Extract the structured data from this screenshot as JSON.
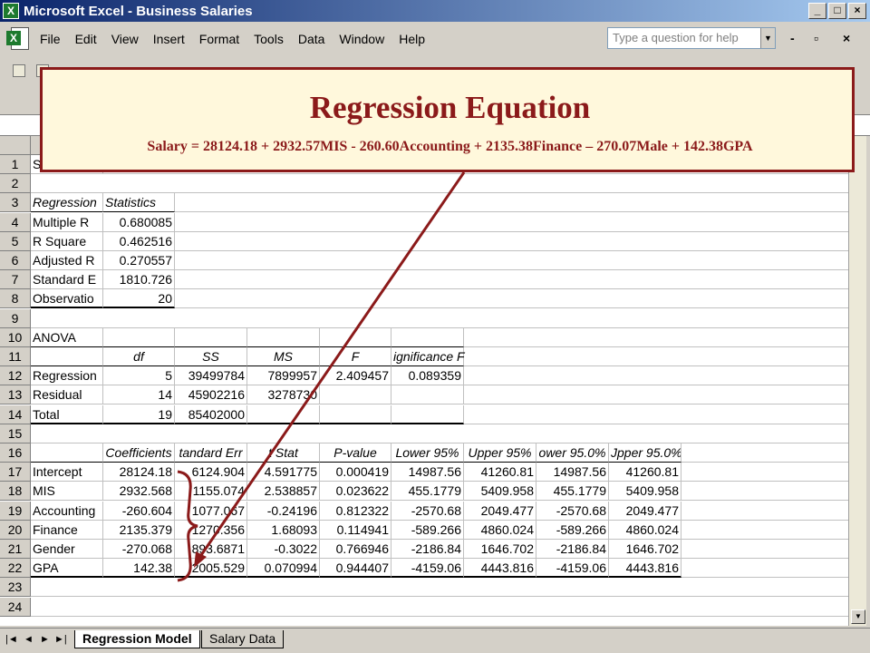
{
  "window": {
    "title": "Microsoft Excel - Business Salaries",
    "min_glyph": "_",
    "max_glyph": "□",
    "close_glyph": "×"
  },
  "menu": {
    "items": [
      "File",
      "Edit",
      "View",
      "Insert",
      "Format",
      "Tools",
      "Data",
      "Window",
      "Help"
    ],
    "question_placeholder": "Type a question for help",
    "doc_min": "-",
    "doc_restore": "▫",
    "doc_close": "×"
  },
  "sheet": {
    "row_numbers": [
      "1",
      "2",
      "3",
      "4",
      "5",
      "6",
      "7",
      "8",
      "9",
      "10",
      "11",
      "12",
      "13",
      "14",
      "15",
      "16",
      "17",
      "18",
      "19",
      "20",
      "21",
      "22",
      "23",
      "24"
    ],
    "a1": "S",
    "regression_stats": {
      "header": [
        "Regression",
        "Statistics"
      ],
      "rows": [
        {
          "label": "Multiple R",
          "value": "0.680085"
        },
        {
          "label": "R Square",
          "value": "0.462516"
        },
        {
          "label": "Adjusted R",
          "value": "0.270557"
        },
        {
          "label": "Standard E",
          "value": "1810.726"
        },
        {
          "label": "Observatio",
          "value": "20"
        }
      ]
    },
    "anova": {
      "title": "ANOVA",
      "headers": [
        "df",
        "SS",
        "MS",
        "F",
        "ignificance F"
      ],
      "rows": [
        {
          "label": "Regression",
          "values": [
            "5",
            "39499784",
            "7899957",
            "2.409457",
            "0.089359"
          ]
        },
        {
          "label": "Residual",
          "values": [
            "14",
            "45902216",
            "3278730",
            "",
            ""
          ]
        },
        {
          "label": "Total",
          "values": [
            "19",
            "85402000",
            "",
            "",
            ""
          ]
        }
      ]
    },
    "coefficients": {
      "headers": [
        "Coefficients",
        "tandard Err",
        "t Stat",
        "P-value",
        "Lower 95%",
        "Upper 95%",
        "ower 95.0%",
        "Jpper 95.0%"
      ],
      "rows": [
        {
          "label": "Intercept",
          "values": [
            "28124.18",
            "6124.904",
            "4.591775",
            "0.000419",
            "14987.56",
            "41260.81",
            "14987.56",
            "41260.81"
          ]
        },
        {
          "label": "MIS",
          "values": [
            "2932.568",
            "1155.074",
            "2.538857",
            "0.023622",
            "455.1779",
            "5409.958",
            "455.1779",
            "5409.958"
          ]
        },
        {
          "label": "Accounting",
          "values": [
            "-260.604",
            "1077.067",
            "-0.24196",
            "0.812322",
            "-2570.68",
            "2049.477",
            "-2570.68",
            "2049.477"
          ]
        },
        {
          "label": "Finance",
          "values": [
            "2135.379",
            "1270.356",
            "1.68093",
            "0.114941",
            "-589.266",
            "4860.024",
            "-589.266",
            "4860.024"
          ]
        },
        {
          "label": "Gender",
          "values": [
            "-270.068",
            "893.6871",
            "-0.3022",
            "0.766946",
            "-2186.84",
            "1646.702",
            "-2186.84",
            "1646.702"
          ]
        },
        {
          "label": "GPA",
          "values": [
            "142.38",
            "2005.529",
            "0.070994",
            "0.944407",
            "-4159.06",
            "4443.816",
            "-4159.06",
            "4443.816"
          ]
        }
      ]
    }
  },
  "tabs": {
    "nav": [
      "|◄",
      "◄",
      "►",
      "►|"
    ],
    "sheets": [
      "Regression Model",
      "Salary Data"
    ]
  },
  "callout": {
    "title": "Regression  Equation",
    "equation": "Salary = 28124.18 + 2932.57MIS - 260.60Accounting + 2135.38Finance – 270.07Male + 142.38GPA"
  },
  "colors": {
    "callout_accent": "#8b1a1a",
    "callout_bg": "#fff8dc",
    "titlebar": "#0a246a"
  }
}
